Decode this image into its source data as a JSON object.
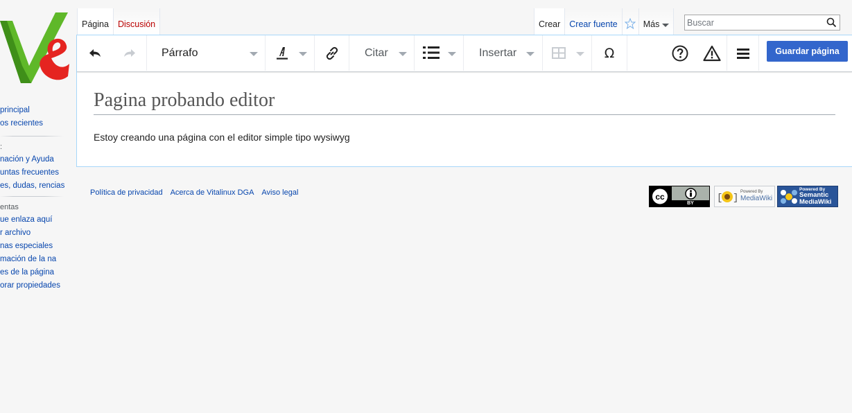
{
  "tabs_left": [
    {
      "label": "Página",
      "state": "selected"
    },
    {
      "label": "Discusión",
      "state": "new"
    }
  ],
  "tabs_right": [
    {
      "label": "Crear",
      "state": "selected"
    },
    {
      "label": "Crear fuente",
      "state": "link"
    }
  ],
  "more_menu_label": "Más",
  "search": {
    "placeholder": "Buscar"
  },
  "sidebar": {
    "group1": [
      "principal",
      "os recientes"
    ],
    "group2_heading": ":",
    "group2": [
      "nación y Ayuda",
      "untas frecuentes",
      "es, dudas, rencias"
    ],
    "group3_heading": "entas",
    "group3": [
      "ue enlaza aquí",
      "r archivo",
      "nas especiales",
      "mación de la na",
      "es de la página",
      "orar propiedades"
    ]
  },
  "toolbar": {
    "paragraph_label": "Párrafo",
    "cite_label": "Citar",
    "insert_label": "Insertar",
    "save_label": "Guardar página"
  },
  "article": {
    "title": "Pagina probando editor",
    "body": "Estoy creando una página con el editor simple tipo wysiwyg"
  },
  "footer": {
    "links": [
      "Política de privacidad",
      "Acerca de Vitalinux DGA",
      "Aviso legal"
    ],
    "badges": {
      "cc_by": "BY",
      "powered_by": "Powered By",
      "mediawiki": "MediaWiki",
      "smw_powered": "Powered By",
      "smw_line1": "Semantic",
      "smw_line2": "MediaWiki"
    }
  },
  "colors": {
    "accent": "#3366cc",
    "link": "#0645ad",
    "new_link": "#ba0000",
    "logo_green": "#5fb829",
    "logo_red": "#e52420"
  },
  "icons": [
    "undo-icon",
    "redo-icon",
    "text-style-icon",
    "link-icon",
    "list-icon",
    "table-icon",
    "special-character-icon",
    "help-icon",
    "notices-icon",
    "page-options-icon",
    "search-icon",
    "watch-star-icon"
  ]
}
